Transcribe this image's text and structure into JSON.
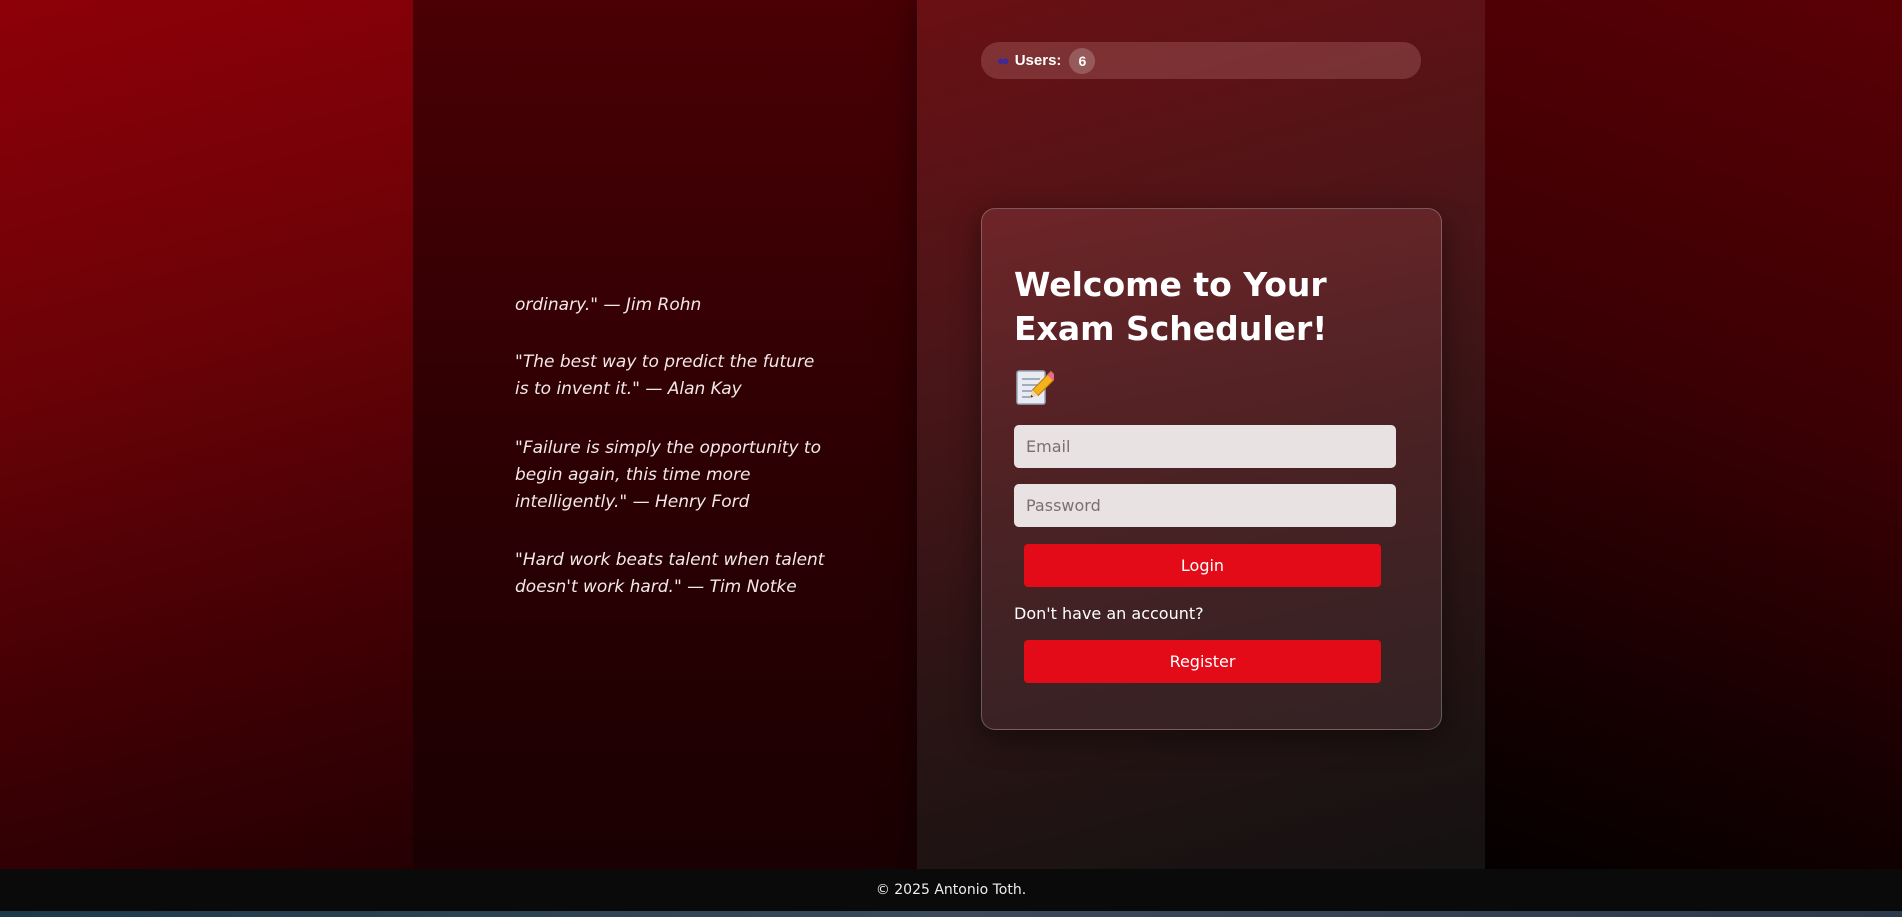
{
  "users": {
    "label": "Users:",
    "count": "6",
    "icon": "users-icon"
  },
  "quotes": [
    "ordinary.\" — Jim Rohn",
    "\"The best way to predict the future is to invent it.\" — Alan Kay",
    "\"Failure is simply the opportunity to begin again, this time more intelligently.\" — Henry Ford",
    "\"Hard work beats talent when talent doesn't work hard.\" — Tim Notke"
  ],
  "login": {
    "title": "Welcome to Your Exam Scheduler!",
    "icon": "memo-icon",
    "email_placeholder": "Email",
    "password_placeholder": "Password",
    "login_label": "Login",
    "no_account_text": "Don't have an account?",
    "register_label": "Register"
  },
  "footer": {
    "text": "© 2025 Antonio Toth."
  },
  "colors": {
    "accent": "#e30b18",
    "background": "#5a0006"
  }
}
